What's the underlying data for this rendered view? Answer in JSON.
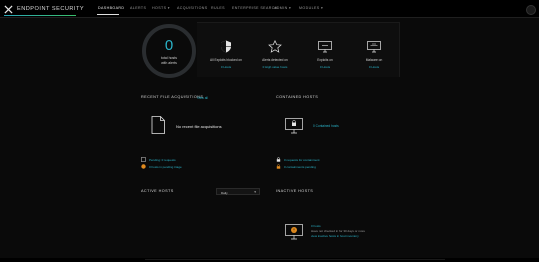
{
  "app": {
    "name": "ENDPOINT SECURITY"
  },
  "nav": {
    "items": [
      {
        "label": "DASHBOARD",
        "active": true
      },
      {
        "label": "ALERTS",
        "active": false
      },
      {
        "label": "HOSTS ▾",
        "active": false
      },
      {
        "label": "ACQUISITIONS",
        "active": false
      },
      {
        "label": "RULES",
        "active": false
      },
      {
        "label": "ENTERPRISE SEARCH",
        "active": false
      },
      {
        "label": "ADMIN ▾",
        "active": false
      },
      {
        "label": "MODULES ▾",
        "active": false
      }
    ]
  },
  "summary": {
    "count": "0",
    "label_line1": "total hosts",
    "label_line2": "with alerts",
    "accent_color": "#2ab3c8"
  },
  "stats": [
    {
      "icon": "shield-icon",
      "title": "All Exploits blocked on",
      "sub": "0  Hosts"
    },
    {
      "icon": "star-icon",
      "title": "Alerts detected on",
      "sub": "0  High value hosts"
    },
    {
      "icon": "exploit-monitor-icon",
      "title": "Exploits on",
      "sub": "0  Hosts"
    },
    {
      "icon": "malware-monitor-icon",
      "title": "Malware on",
      "sub": "0  Hosts"
    }
  ],
  "recent_acquisitions": {
    "title": "RECENT FILE ACQUISITIONS",
    "view_all": "View all",
    "empty": "No recent file acquisitions",
    "pending": "Pending: 0 requests",
    "waiting": "0 hosts in pending triage"
  },
  "contained_hosts": {
    "title": "CONTAINED HOSTS",
    "count_label": "0  Contained hosts",
    "requests": "0  requests for containment",
    "pending": "0  containments pending"
  },
  "active_hosts": {
    "title": "ACTIVE HOSTS",
    "range": "Daily"
  },
  "inactive_hosts": {
    "title": "INACTIVE HOSTS",
    "count": "0  hosts",
    "desc": "Have not checked in for 30 days or more",
    "link": "view inactive hosts in host inventory"
  }
}
